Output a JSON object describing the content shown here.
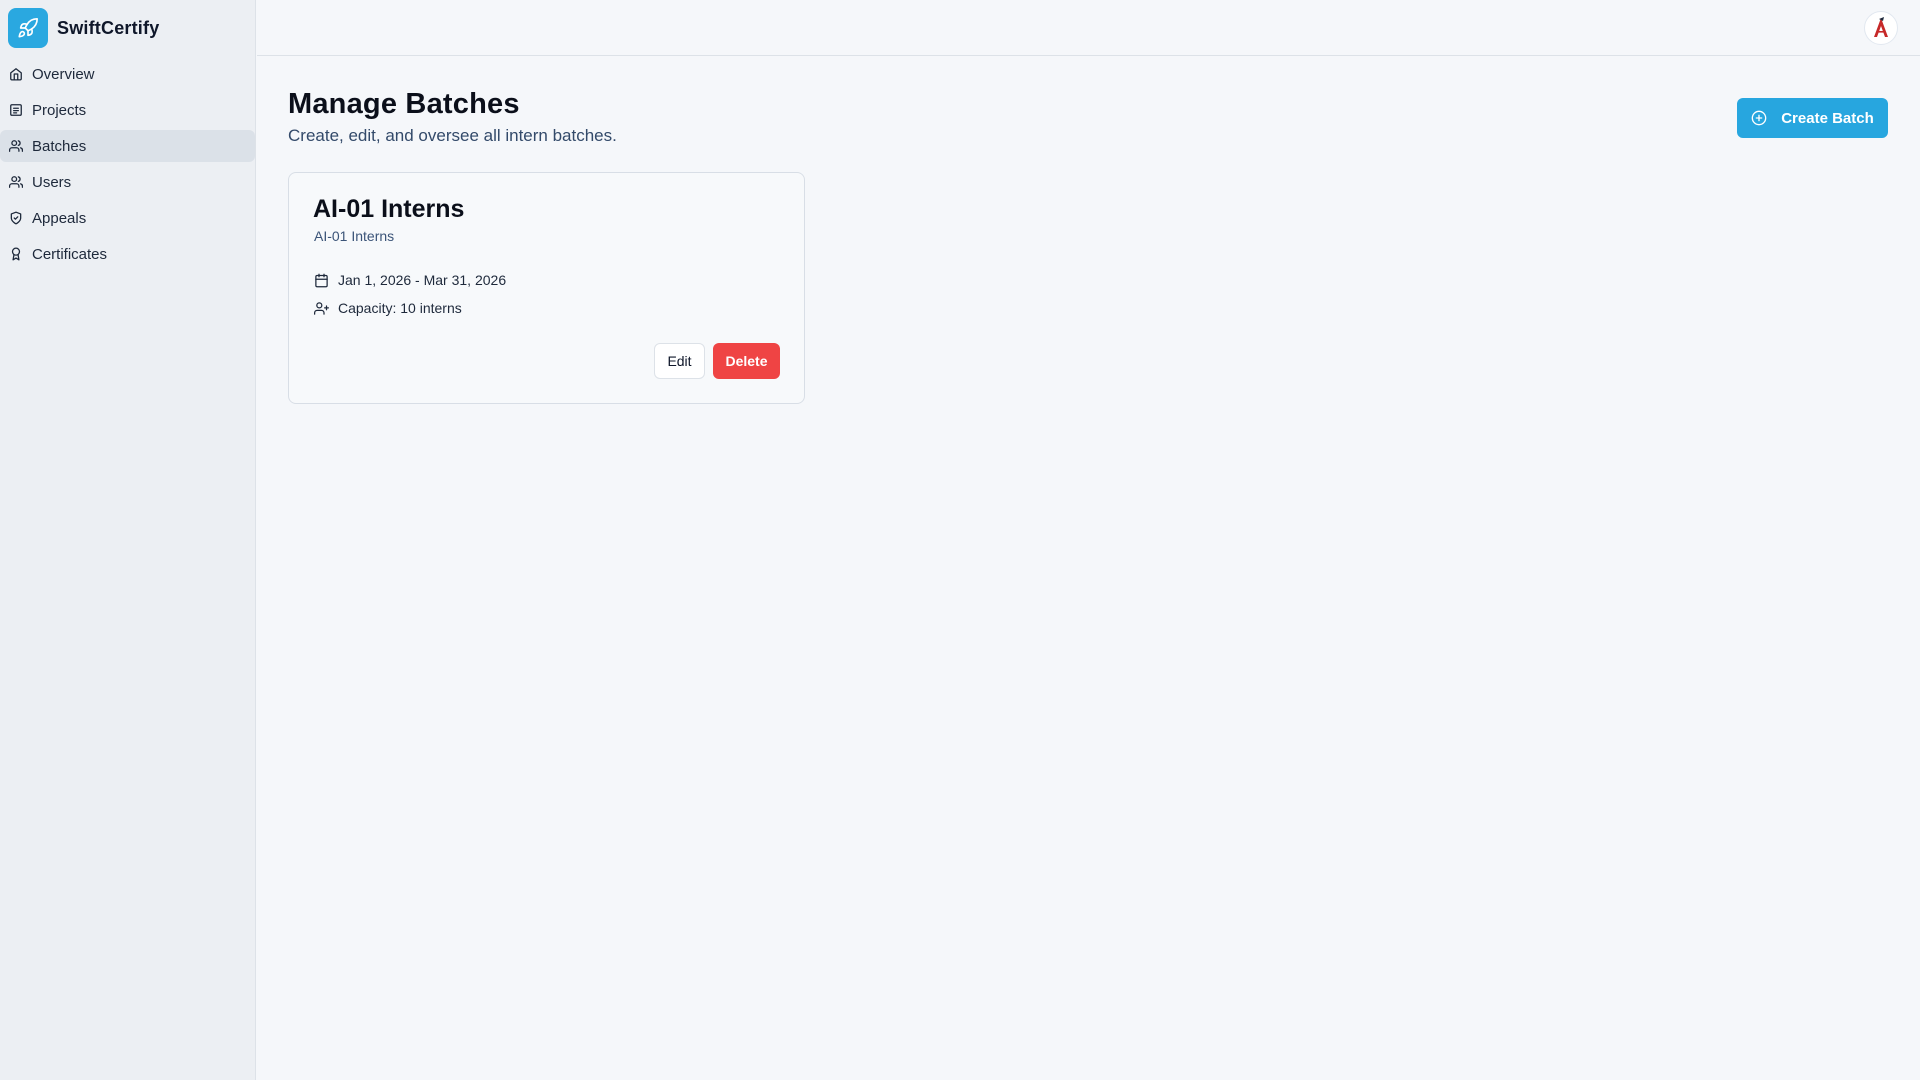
{
  "app": {
    "name": "SwiftCertify",
    "brand_color": "#27a6df",
    "logo_icon": "rocket-icon"
  },
  "sidebar": {
    "items": [
      {
        "label": "Overview",
        "icon": "home-icon",
        "active": false
      },
      {
        "label": "Projects",
        "icon": "document-icon",
        "active": false
      },
      {
        "label": "Batches",
        "icon": "users-icon",
        "active": true
      },
      {
        "label": "Users",
        "icon": "users-icon",
        "active": false
      },
      {
        "label": "Appeals",
        "icon": "shield-icon",
        "active": false
      },
      {
        "label": "Certificates",
        "icon": "award-icon",
        "active": false
      }
    ]
  },
  "header": {
    "avatar_icon": "user-avatar"
  },
  "page": {
    "title": "Manage Batches",
    "subtitle": "Create, edit, and oversee all intern batches.",
    "create_button": "Create Batch",
    "create_icon": "plus-circle-icon"
  },
  "batches": [
    {
      "name": "AI-01 Interns",
      "description": "AI-01 Interns",
      "dates": "Jan 1, 2026 - Mar 31, 2026",
      "capacity": "Capacity: 10 interns",
      "edit_label": "Edit",
      "delete_label": "Delete"
    }
  ],
  "colors": {
    "danger": "#ef4444",
    "sidebar_bg": "#eceff3",
    "active_item_bg": "#dbe1e8"
  }
}
